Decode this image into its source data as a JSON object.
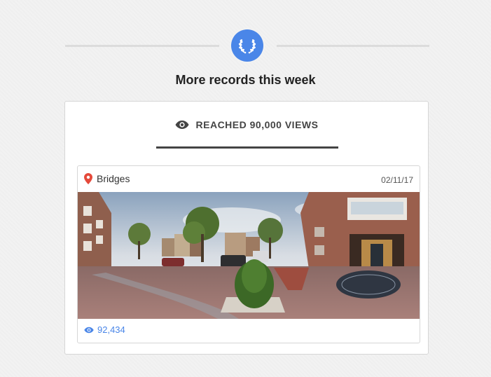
{
  "header": {
    "badge_icon": "laurel-wreath-icon",
    "badge_color": "#4a86e8",
    "title": "More records this week"
  },
  "record": {
    "icon": "eye-icon",
    "title": "REACHED 90,000 VIEWS",
    "item": {
      "location_icon": "map-pin-icon",
      "location": "Bridges",
      "date": "02/11/17",
      "views_icon": "eye-icon",
      "views": "92,434",
      "accent_color": "#4a86e8",
      "pin_color": "#e5493a"
    }
  }
}
